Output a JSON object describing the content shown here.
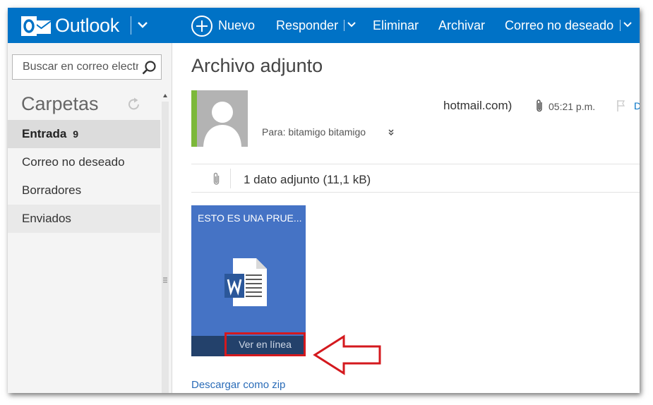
{
  "colors": {
    "brand_blue": "#0072c6",
    "sender_accent": "#7cb83a",
    "attachment_tile": "#4573c5",
    "attachment_footer": "#23416b",
    "highlight_red": "#d4191e",
    "link": "#2a6cb8"
  },
  "app": {
    "name": "Outlook",
    "logo_icon": "outlook-logo",
    "menu_icon": "chevron-down-icon"
  },
  "toolbar": {
    "new_icon": "plus-circle-icon",
    "new_label": "Nuevo",
    "reply_label": "Responder",
    "delete_label": "Eliminar",
    "archive_label": "Archivar",
    "junk_label": "Correo no deseado"
  },
  "sidebar": {
    "search_placeholder": "Buscar en correo electrónico",
    "search_icon": "search-icon",
    "folders_heading": "Carpetas",
    "refresh_icon": "refresh-icon",
    "folders": [
      {
        "label": "Entrada",
        "count": "9",
        "selected": true
      },
      {
        "label": "Correo no deseado"
      },
      {
        "label": "Borradores"
      },
      {
        "label": "Enviados"
      }
    ]
  },
  "message": {
    "subject": "Archivo adjunto",
    "sender": "hotmail.com)",
    "time": "05:21 p.m.",
    "reply_hint": "D",
    "recipients": "Para: bitamigo bitamigo",
    "attachment_summary": "1 dato adjunto (11,1 kB)",
    "attachment": {
      "name": "ESTO ES UNA PRUE...",
      "file_icon": "word-document-icon",
      "view_online_label": "Ver en línea"
    },
    "download_zip_label": "Descargar como zip"
  }
}
